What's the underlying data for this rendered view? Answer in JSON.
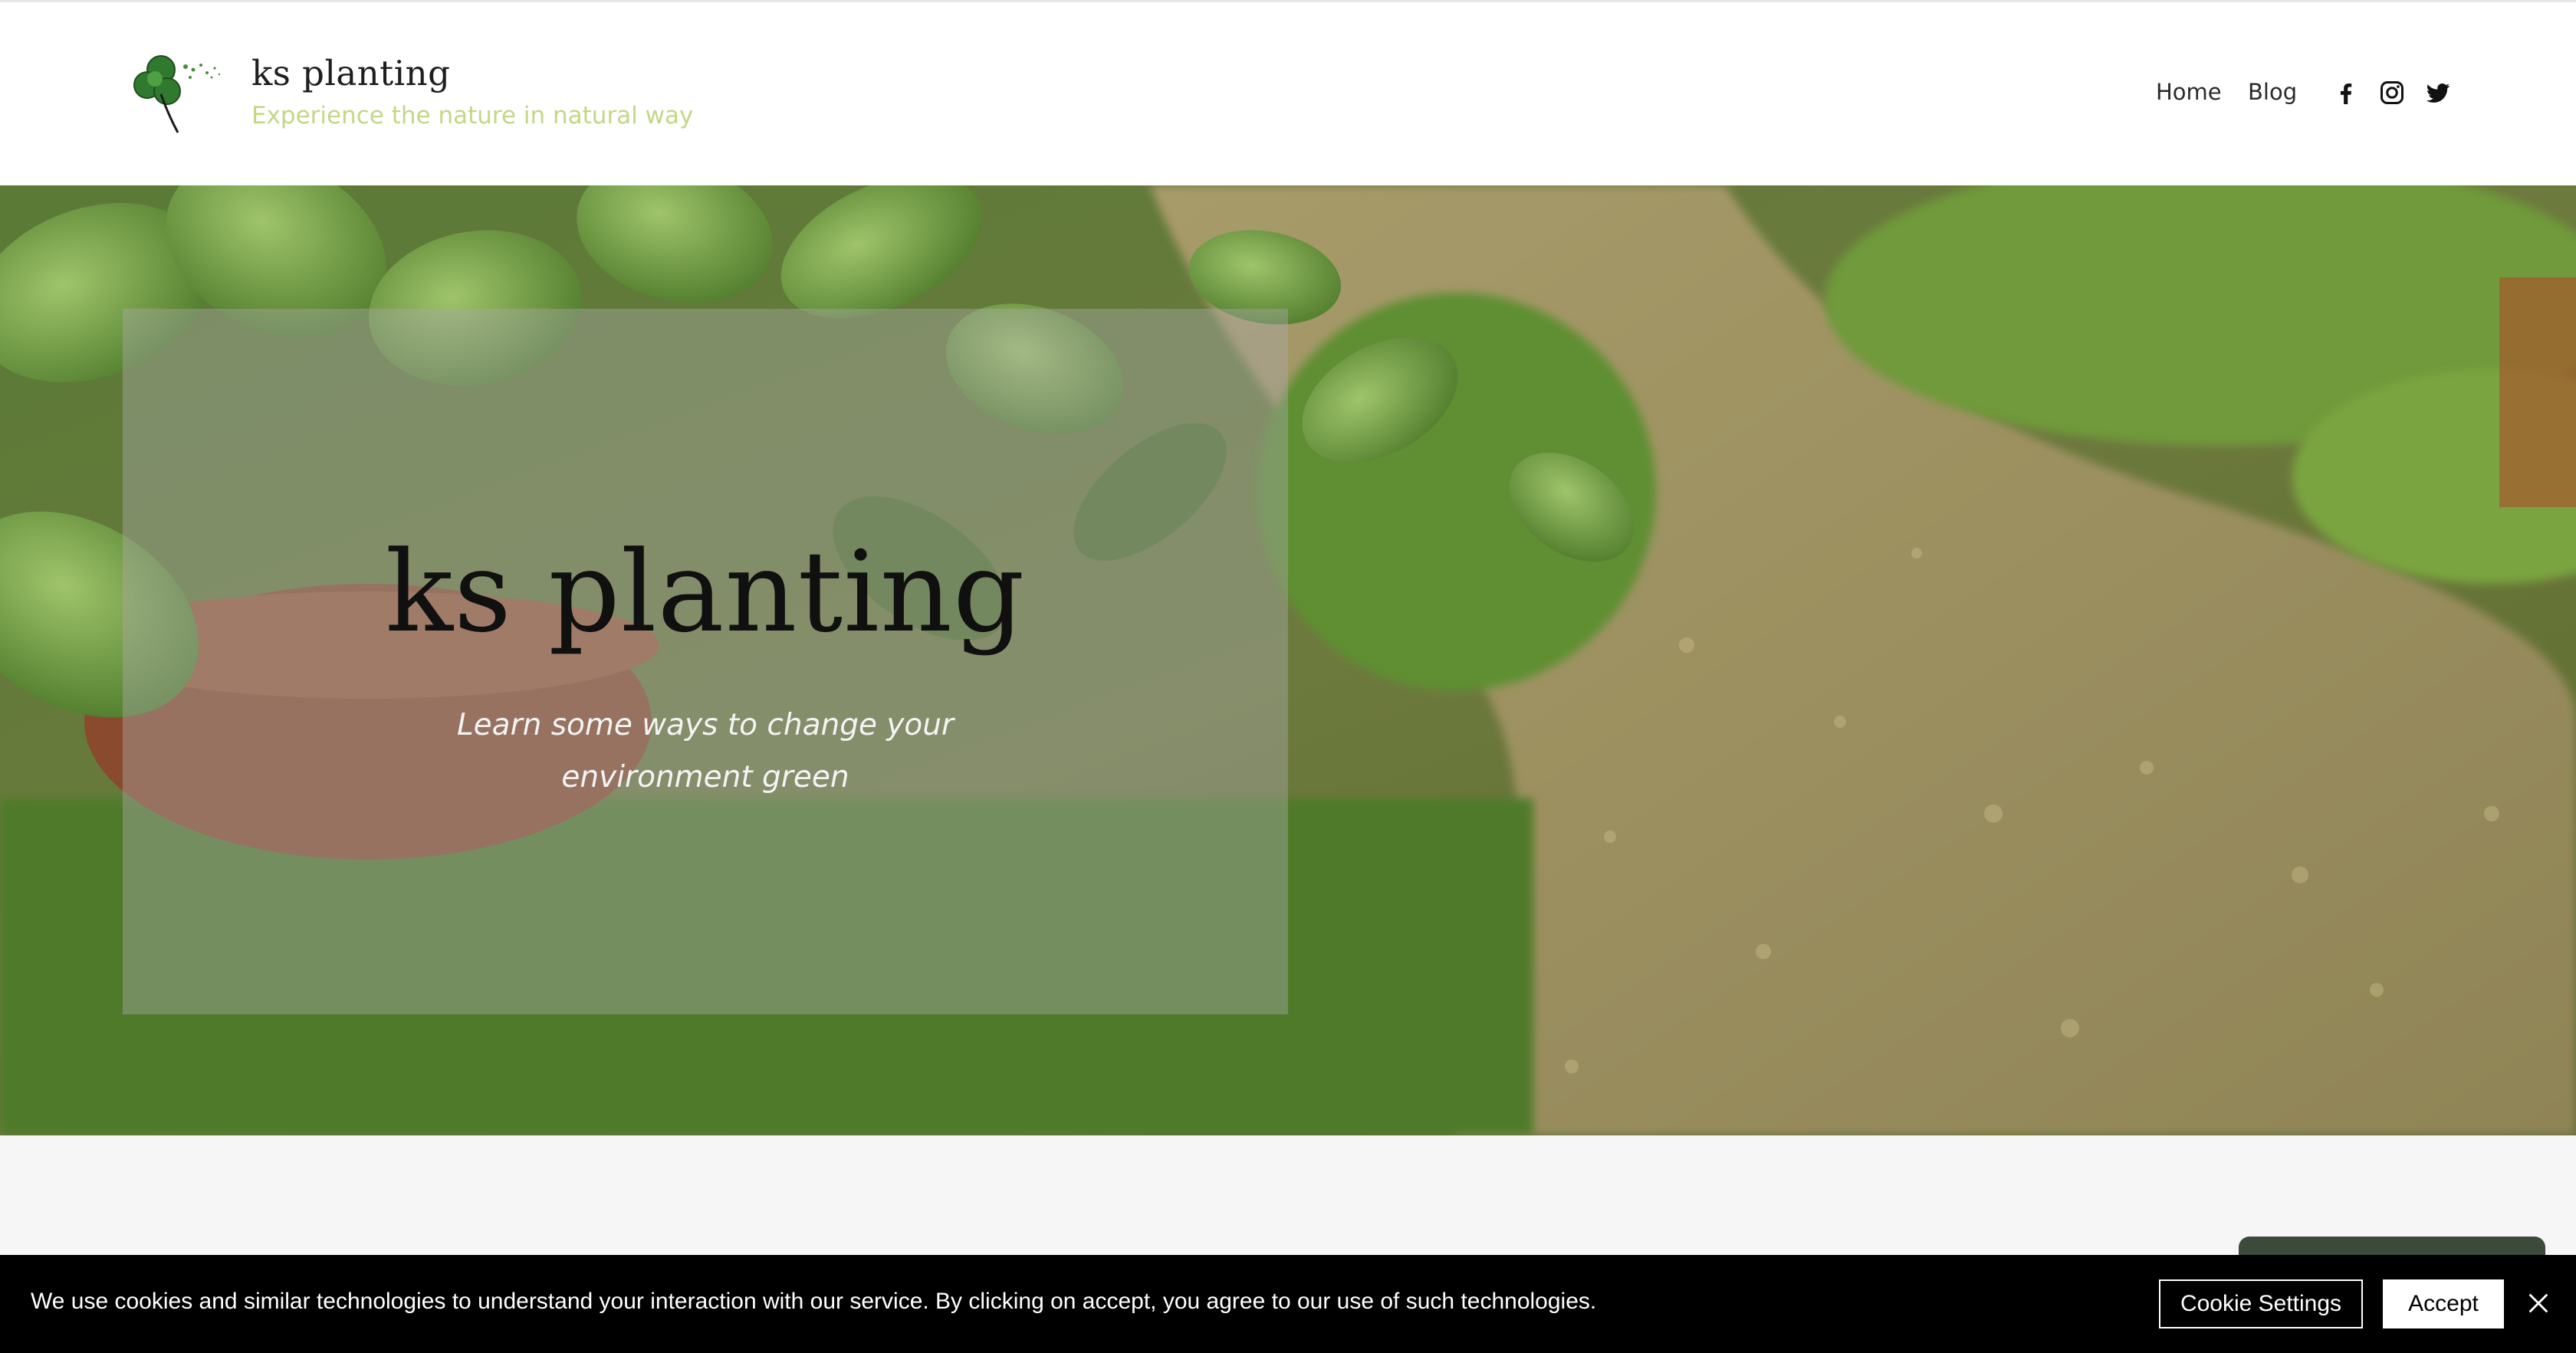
{
  "site": {
    "name": "ks planting",
    "tagline": "Experience the nature in natural way"
  },
  "nav": {
    "items": [
      {
        "label": "Home"
      },
      {
        "label": "Blog"
      }
    ]
  },
  "social": [
    "facebook-icon",
    "instagram-icon",
    "twitter-icon"
  ],
  "hero": {
    "title": "ks planting",
    "subtitle": "Learn some ways to change your environment green"
  },
  "cookie": {
    "message": "We use cookies and similar technologies to understand your interaction with our service. By clicking on accept, you agree to our use of such technologies.",
    "settings_label": "Cookie Settings",
    "accept_label": "Accept"
  },
  "colors": {
    "tagline": "#c3d786",
    "header_bg": "#ffffff",
    "cookie_bg": "#000000",
    "page_bg": "#f6f6f6"
  }
}
